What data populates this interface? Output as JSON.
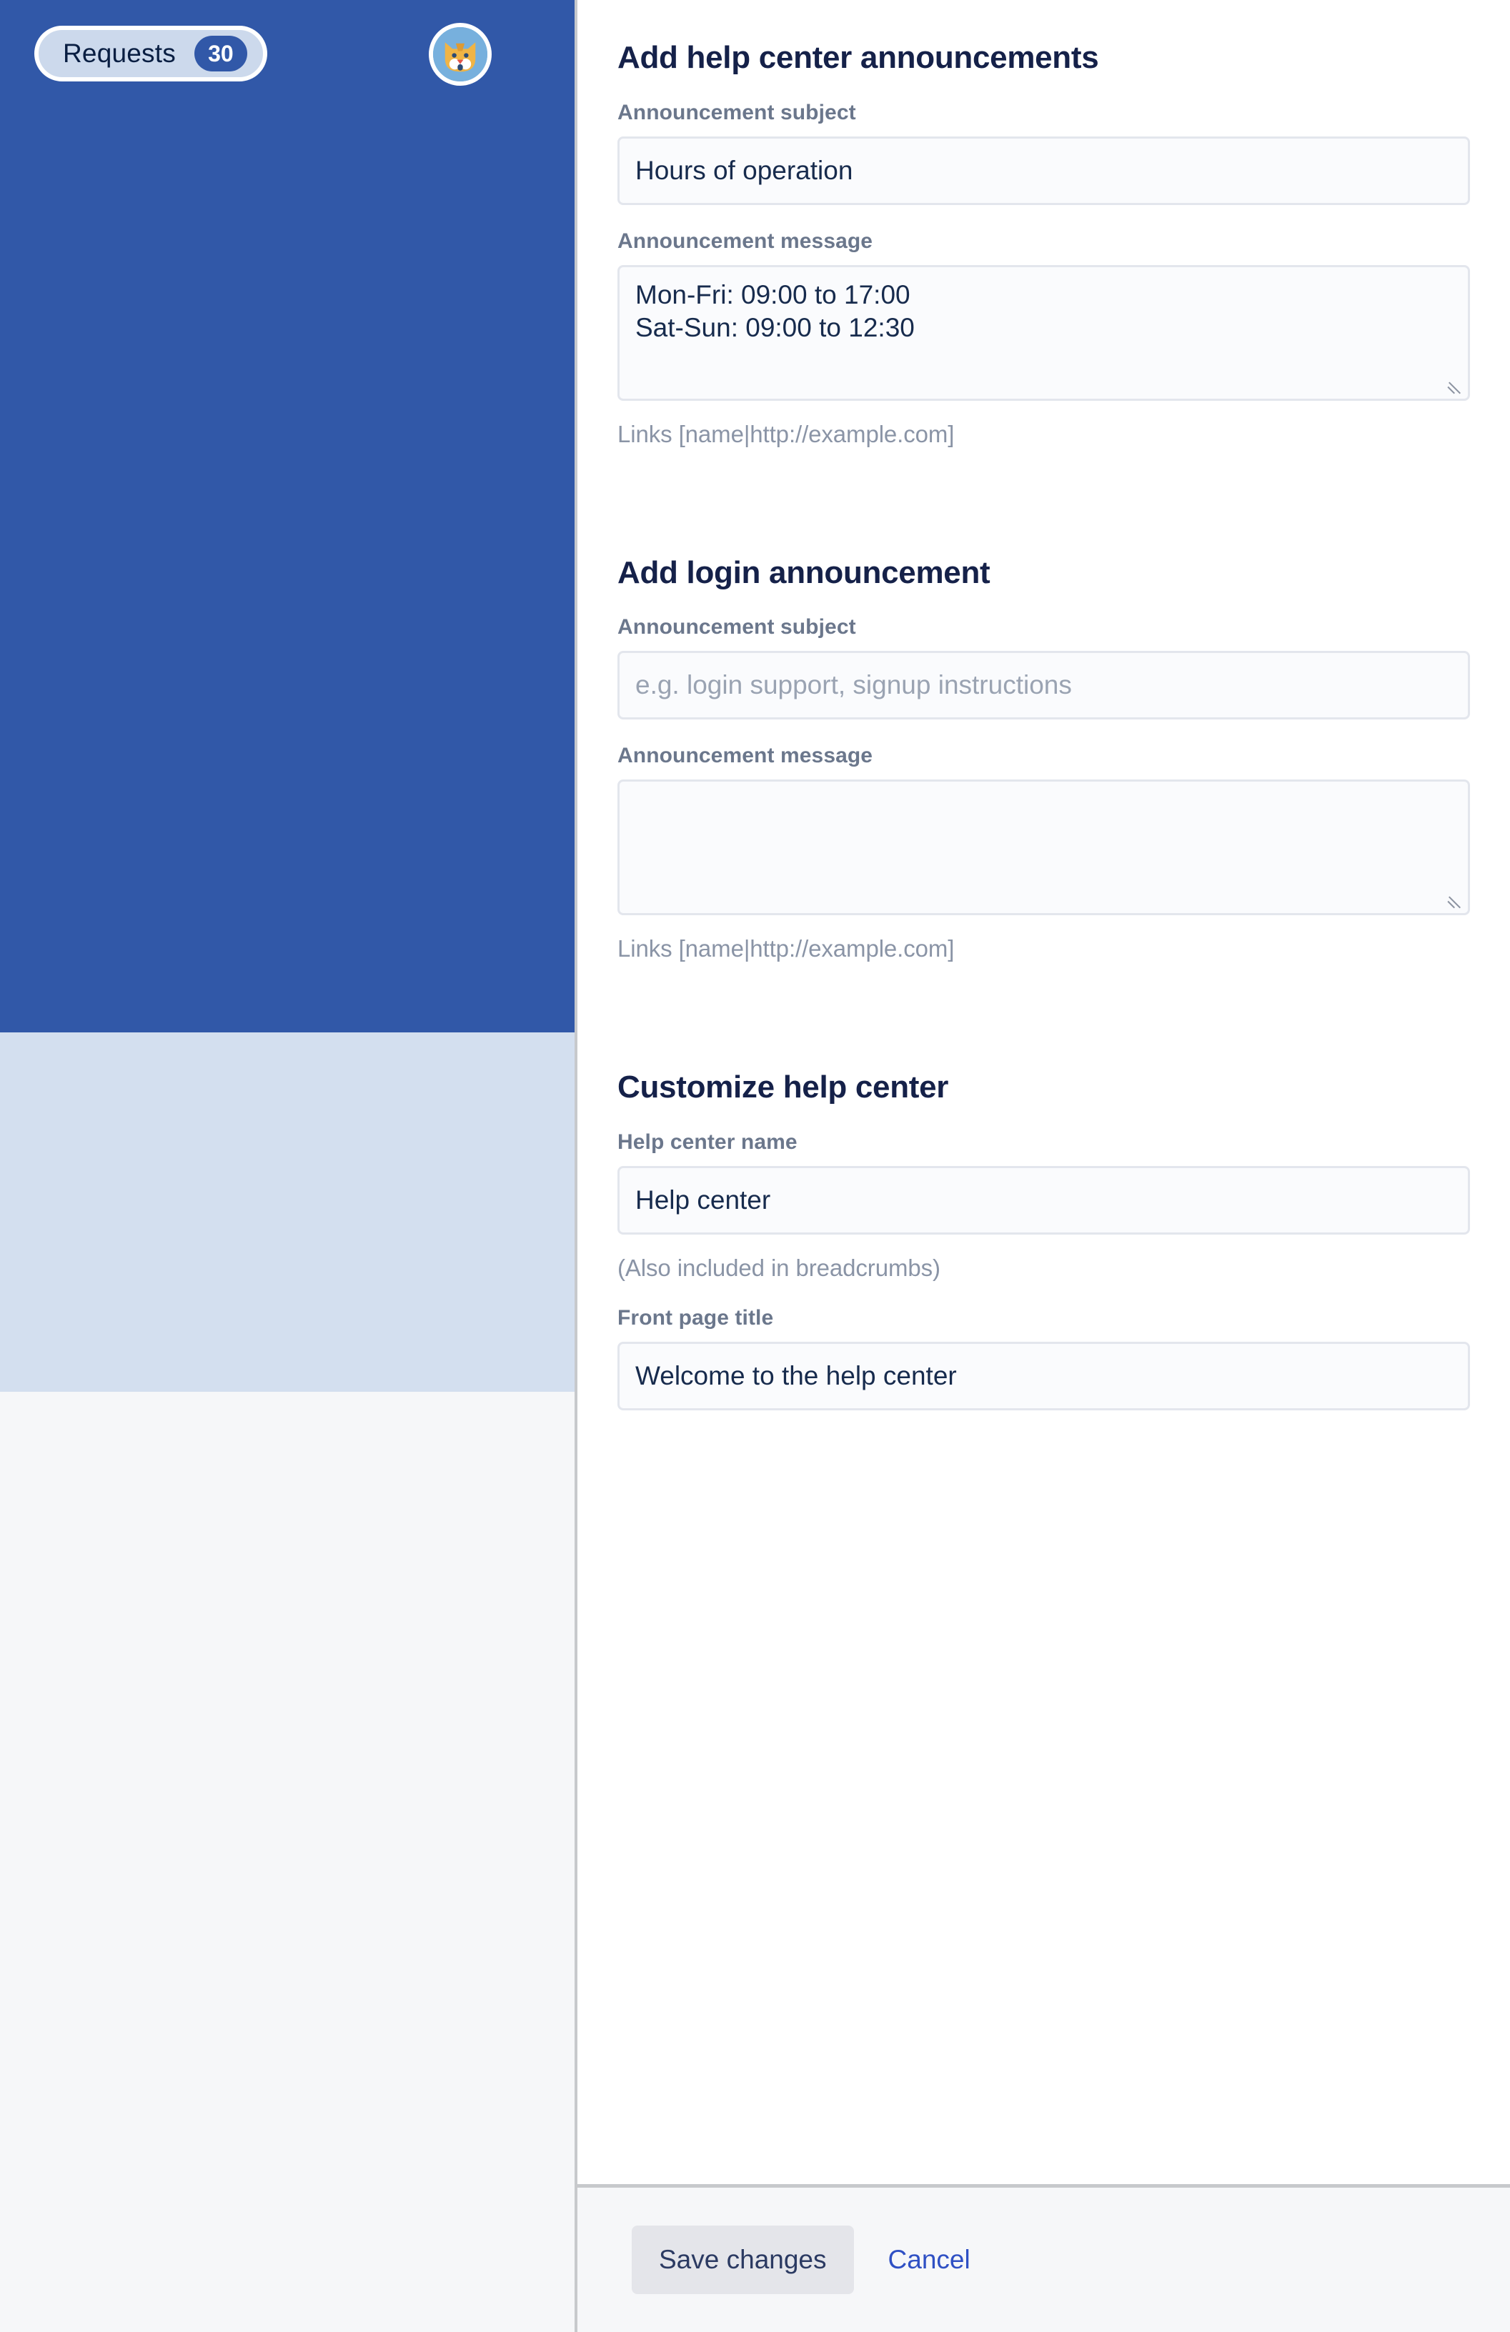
{
  "sidebar": {
    "requests": {
      "label": "Requests",
      "count": "30",
      "badge_color": "#3158a8",
      "pill_color": "#ccd9ec"
    },
    "avatar": {
      "icon": "cat-avatar-icon",
      "background_color": "#77b0dd",
      "fur_color": "#f0b445"
    },
    "bands": {
      "primary_color": "#3158a8",
      "secondary_color": "#d3dfef",
      "tertiary_color": "#f6f7f9"
    }
  },
  "main": {
    "sections": [
      {
        "title": "Add help center announcements",
        "subject_label": "Announcement subject",
        "subject_value": "Hours of operation",
        "subject_placeholder": "",
        "message_label": "Announcement message",
        "message_value": "Mon-Fri: 09:00 to 17:00\nSat-Sun: 09:00 to 12:30",
        "message_placeholder": "",
        "links_hint": "Links [name|http://example.com]"
      },
      {
        "title": "Add login announcement",
        "subject_label": "Announcement subject",
        "subject_value": "",
        "subject_placeholder": "e.g. login support, signup instructions",
        "message_label": "Announcement message",
        "message_value": "",
        "message_placeholder": "",
        "links_hint": "Links [name|http://example.com]"
      }
    ],
    "customize": {
      "title": "Customize help center",
      "name_label": "Help center name",
      "name_value": "Help center",
      "name_hint": "(Also included in breadcrumbs)",
      "front_page_label": "Front page title",
      "front_page_value": "Welcome to the help center"
    }
  },
  "footer": {
    "save_label": "Save changes",
    "cancel_label": "Cancel",
    "cancel_color": "#2f50c4"
  }
}
